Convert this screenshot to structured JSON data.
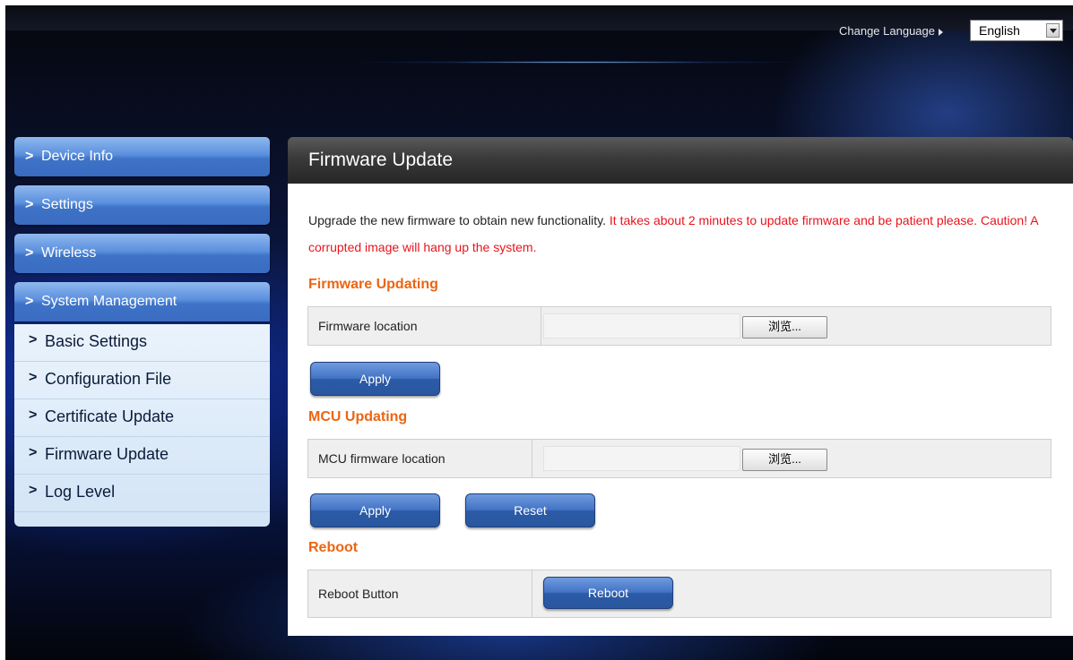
{
  "header": {
    "change_language_label": "Change Language",
    "language_value": "English"
  },
  "sidebar": {
    "items": [
      {
        "label": "Device Info"
      },
      {
        "label": "Settings"
      },
      {
        "label": "Wireless"
      },
      {
        "label": "System Management"
      }
    ],
    "sub_items": [
      {
        "label": "Basic Settings"
      },
      {
        "label": "Configuration File"
      },
      {
        "label": "Certificate Update"
      },
      {
        "label": "Firmware Update"
      },
      {
        "label": "Log Level"
      }
    ]
  },
  "main": {
    "title": "Firmware Update",
    "intro_normal": "Upgrade the new firmware to obtain new functionality.",
    "intro_warning": "It takes about 2 minutes to update firmware and be patient please. Caution! A corrupted image will hang up the system.",
    "firmware_section": {
      "title": "Firmware Updating",
      "field_label": "Firmware location",
      "browse_label": "浏览...",
      "apply_label": "Apply"
    },
    "mcu_section": {
      "title": "MCU Updating",
      "field_label": "MCU firmware location",
      "browse_label": "浏览...",
      "apply_label": "Apply",
      "reset_label": "Reset"
    },
    "reboot_section": {
      "title": "Reboot",
      "field_label": "Reboot Button",
      "reboot_label": "Reboot"
    }
  },
  "colors": {
    "section_title": "#ec6512",
    "warning_text": "#e8141c",
    "button_blue": "#2b5aa7"
  }
}
